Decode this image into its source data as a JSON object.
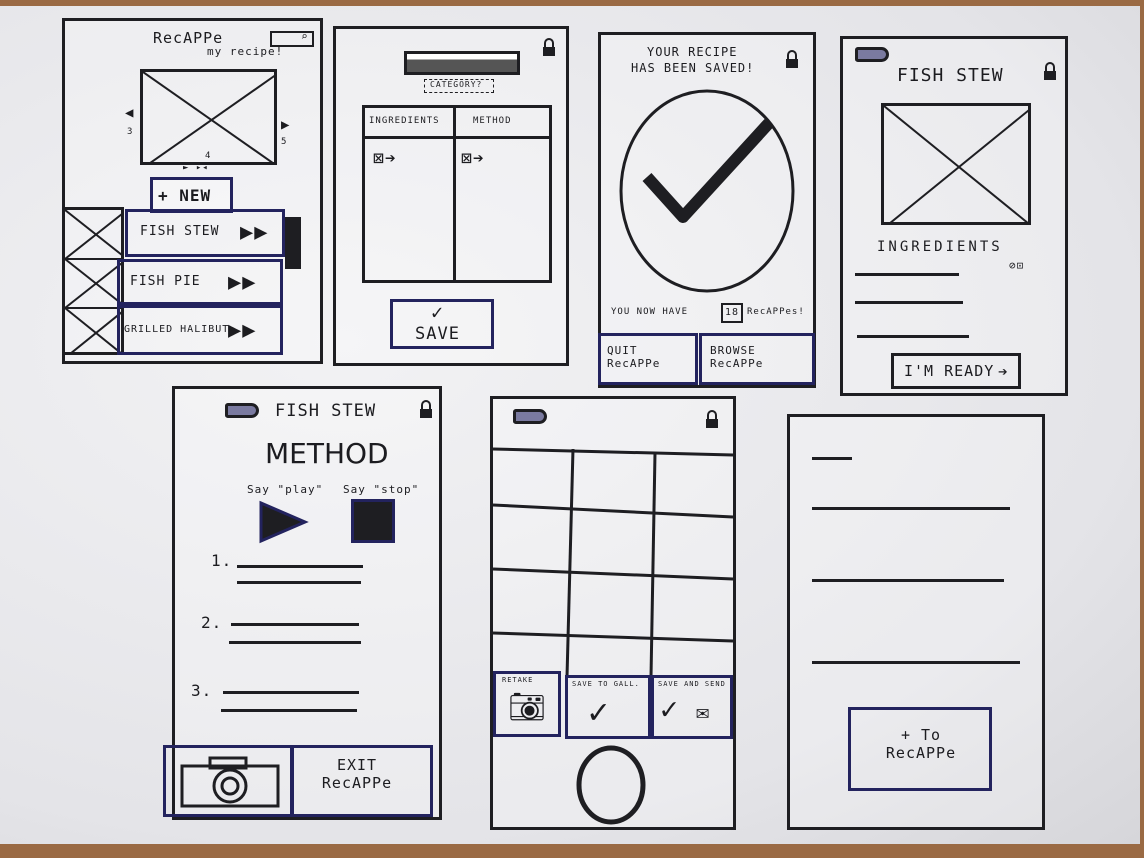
{
  "screen1": {
    "title": "RecAPPe",
    "subtitle": "my recipe!",
    "carousel_numbers": [
      "3",
      "4",
      "5"
    ],
    "new_button": "+ NEW",
    "recipes": [
      "FISH STEW",
      "FISH PIE",
      "GRILLED HALIBUT"
    ]
  },
  "screen2": {
    "category": "CATEGORY?",
    "columns": [
      "INGREDIENTS",
      "METHOD"
    ],
    "save_button": "SAVE"
  },
  "screen3": {
    "message_line1": "YOUR RECIPE",
    "message_line2": "HAS BEEN SAVED!",
    "count_prefix": "YOU NOW HAVE",
    "count": "18",
    "count_suffix": "RecAPPes!",
    "quit_button": "QUIT RecAPPe",
    "browse_button": "BROWSE RecAPPe"
  },
  "screen4": {
    "title": "FISH STEW",
    "section": "INGREDIENTS",
    "ready_button": "I'M READY"
  },
  "screen5": {
    "title": "FISH STEW",
    "heading": "METHOD",
    "say_play": "Say \"play\"",
    "say_stop": "Say \"stop\"",
    "steps": [
      "1.",
      "2.",
      "3."
    ],
    "exit_button": "EXIT RecAPPe"
  },
  "screen6": {
    "buttons": [
      "RETAKE",
      "SAVE TO GALL.",
      "SAVE AND SEND"
    ]
  },
  "screen7": {
    "add_button": "+ To RecAPPe"
  },
  "colors": {
    "ink": "#1e1e22",
    "marker_blue": "#23235e",
    "paper": "#ebebee",
    "table": "#9a6a44"
  }
}
